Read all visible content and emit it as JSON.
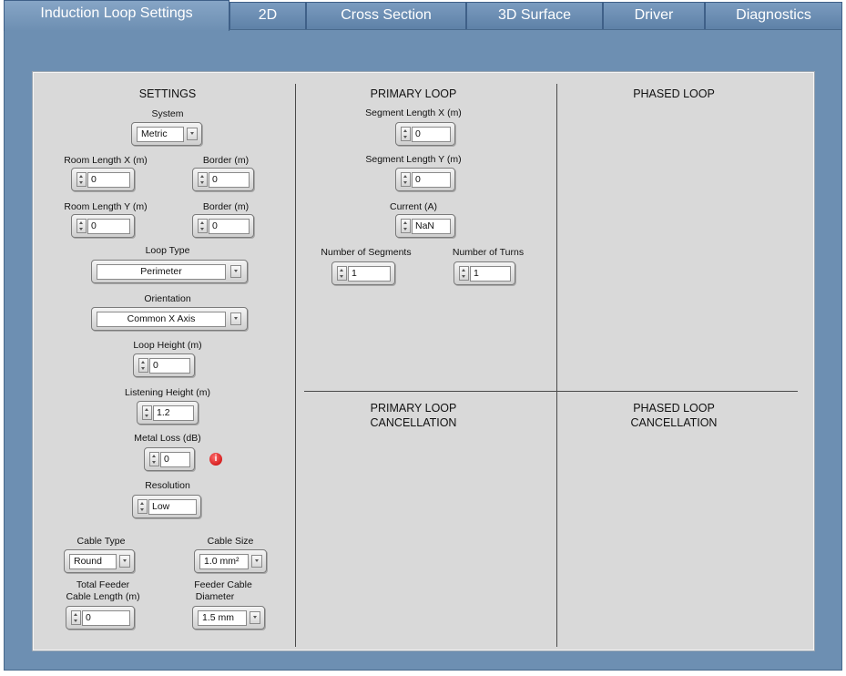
{
  "tabs": [
    {
      "label": "Induction Loop Settings"
    },
    {
      "label": "2D"
    },
    {
      "label": "Cross Section"
    },
    {
      "label": "3D Surface"
    },
    {
      "label": "Driver"
    },
    {
      "label": "Diagnostics"
    }
  ],
  "settings": {
    "title": "SETTINGS",
    "system_label": "System",
    "system_value": "Metric",
    "room_length_x_label": "Room Length X (m)",
    "room_length_x_value": "0",
    "border_x_label": "Border (m)",
    "border_x_value": "0",
    "room_length_y_label": "Room Length Y (m)",
    "room_length_y_value": "0",
    "border_y_label": "Border (m)",
    "border_y_value": "0",
    "loop_type_label": "Loop Type",
    "loop_type_value": "Perimeter",
    "orientation_label": "Orientation",
    "orientation_value": "Common X Axis",
    "loop_height_label": "Loop Height (m)",
    "loop_height_value": "0",
    "listening_height_label": "Listening Height (m)",
    "listening_height_value": "1.2",
    "metal_loss_label": "Metal Loss (dB)",
    "metal_loss_value": "0",
    "resolution_label": "Resolution",
    "resolution_value": "Low",
    "cable_type_label": "Cable Type",
    "cable_type_value": "Round",
    "cable_size_label": "Cable Size",
    "cable_size_value": "1.0 mm²",
    "feeder_length_label_1": "Total Feeder",
    "feeder_length_label_2": "Cable Length (m)",
    "feeder_length_value": "0",
    "feeder_diameter_label_1": "Feeder Cable",
    "feeder_diameter_label_2": "Diameter",
    "feeder_diameter_value": "1.5 mm"
  },
  "primary": {
    "title": "PRIMARY LOOP",
    "seg_x_label": "Segment Length X (m)",
    "seg_x_value": "0",
    "seg_y_label": "Segment Length Y (m)",
    "seg_y_value": "0",
    "current_label": "Current (A)",
    "current_value": "NaN",
    "num_segments_label": "Number of Segments",
    "num_segments_value": "1",
    "num_turns_label": "Number of Turns",
    "num_turns_value": "1"
  },
  "phased": {
    "title": "PHASED LOOP"
  },
  "primary_cancel": {
    "title_1": "PRIMARY LOOP",
    "title_2": "CANCELLATION"
  },
  "phased_cancel": {
    "title_1": "PHASED LOOP",
    "title_2": "CANCELLATION"
  },
  "icons": {
    "warning": "warning-icon"
  },
  "colors": {
    "frame": "#6d8fb2",
    "panel": "#d9d9d9",
    "warning": "#c40000"
  }
}
